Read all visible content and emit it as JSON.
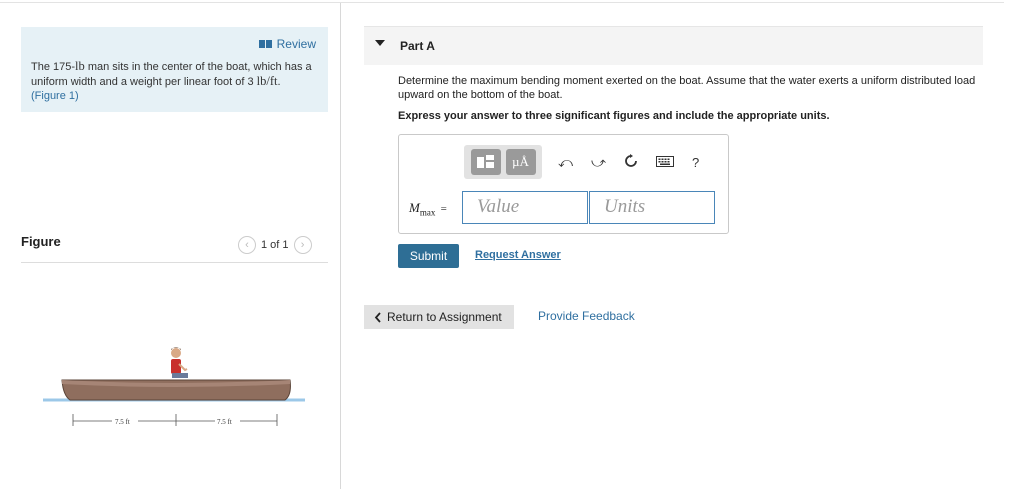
{
  "problem": {
    "review_label": "Review",
    "text_before": "The 175-",
    "unit_weight": "lb",
    "text_middle": " man sits in the center of the boat, which has a uniform width and a weight per linear foot of 3 ",
    "unit_rate": "lb/ft",
    "text_after": ".",
    "figure_link": "(Figure 1)"
  },
  "figure": {
    "heading": "Figure",
    "pager_text": "1 of 1",
    "prev_icon": "chevron-left-icon",
    "next_icon": "chevron-right-icon",
    "dim_left": "7.5 ft",
    "dim_right": "7.5 ft"
  },
  "part": {
    "title": "Part A",
    "question": "Determine the maximum bending moment exerted on the boat. Assume that the water exerts a uniform distributed load upward on the bottom of the boat.",
    "instruction": "Express your answer to three significant figures and include the appropriate units."
  },
  "toolbar": {
    "units_glyph": "µÅ",
    "help_glyph": "?"
  },
  "answer": {
    "var_main": "M",
    "var_sub": "max",
    "equals": "=",
    "value_placeholder": "Value",
    "units_placeholder": "Units"
  },
  "actions": {
    "submit_label": "Submit",
    "request_label": "Request Answer",
    "return_label": "Return to Assignment",
    "feedback_label": "Provide Feedback"
  },
  "colors": {
    "link": "#2f6fa0",
    "submit_bg": "#2e6e95",
    "problem_bg": "#e6f1f6"
  }
}
